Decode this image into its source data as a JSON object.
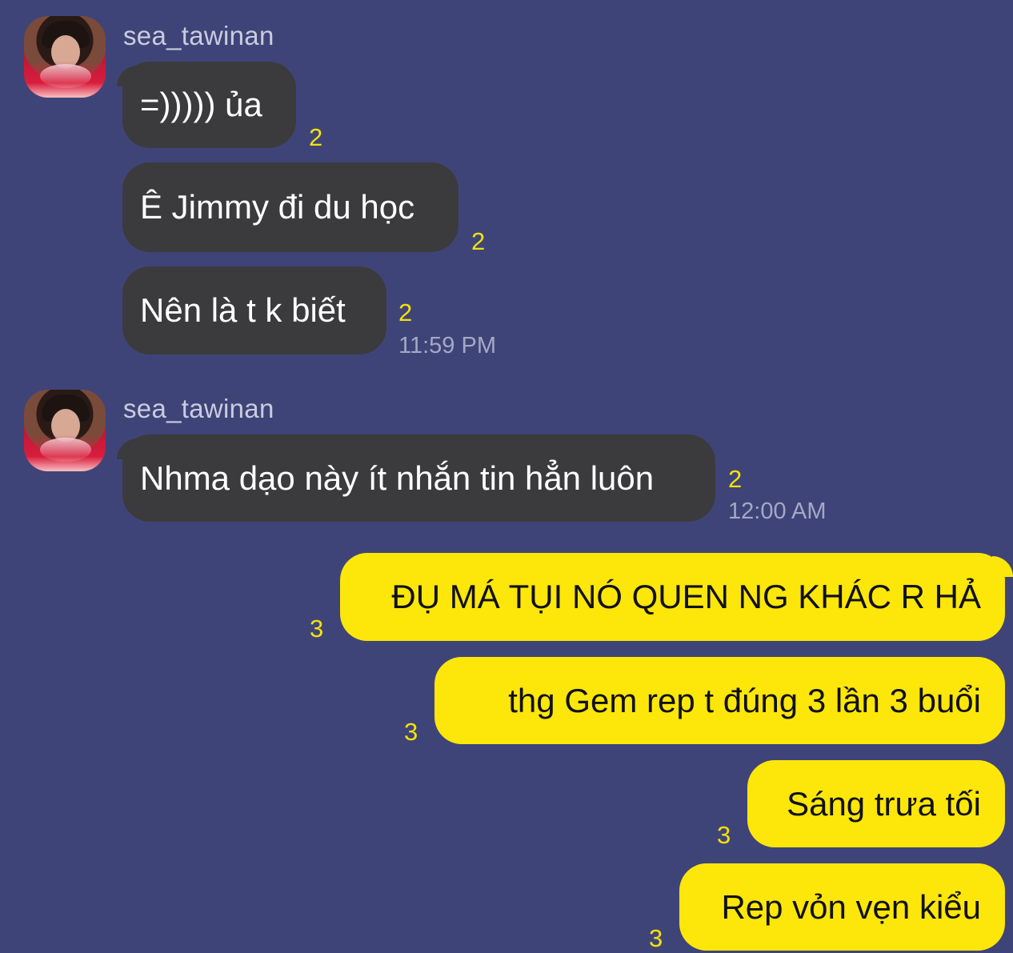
{
  "messages_group_1": {
    "sender": "sea_tawinan",
    "messages": [
      {
        "text": "=))))) ủa",
        "read_count": "2"
      },
      {
        "text": "Ê Jimmy đi du học",
        "read_count": "2"
      },
      {
        "text": "Nên là t k biết",
        "read_count": "2"
      }
    ],
    "time": "11:59 PM"
  },
  "messages_group_2": {
    "sender": "sea_tawinan",
    "messages": [
      {
        "text": "Nhma dạo này ít nhắn tin hẳn luôn",
        "read_count": "2"
      }
    ],
    "time": "12:00 AM"
  },
  "outgoing": {
    "messages": [
      {
        "text": "ĐỤ MÁ TỤI NÓ QUEN NG KHÁC R HẢ",
        "read_count": "3"
      },
      {
        "text": "thg Gem rep t đúng 3 lần 3 buổi",
        "read_count": "3"
      },
      {
        "text": "Sáng trưa tối",
        "read_count": "3"
      },
      {
        "text": "Rep vỏn vẹn kiểu",
        "read_count": "3"
      }
    ]
  },
  "colors": {
    "background": "#3f4478",
    "incoming_bubble": "#3b3b3d",
    "outgoing_bubble": "#fde60a",
    "read_count": "#f2e20c",
    "timestamp": "#a4a8c6"
  }
}
